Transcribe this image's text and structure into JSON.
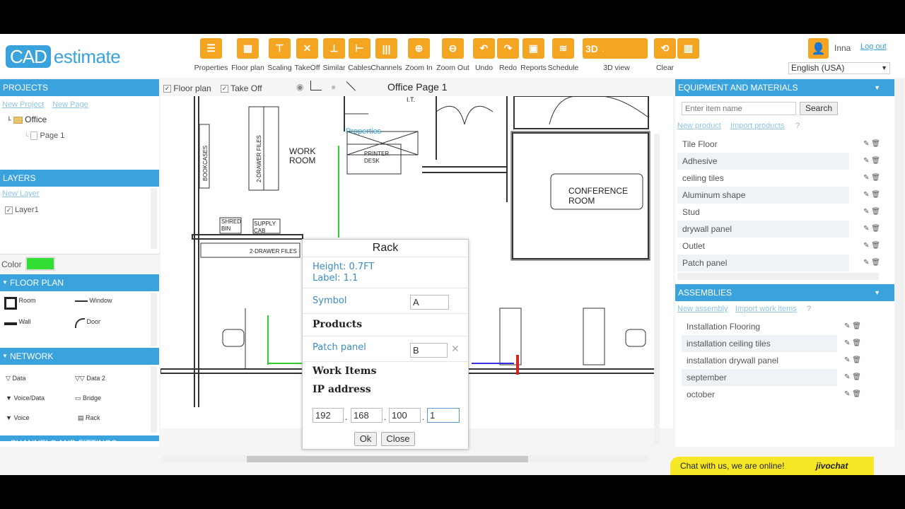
{
  "logo": {
    "part1": "CAD",
    "part2": "estimate"
  },
  "toolbar": [
    {
      "label": "Properties",
      "icon": "list-icon",
      "glyph": "☰"
    },
    {
      "label": "Floor plan",
      "icon": "grid-icon",
      "glyph": "▦"
    },
    {
      "label": "Scaling",
      "icon": "ruler-icon",
      "glyph": "⊤"
    },
    {
      "label": "TakeOff",
      "icon": "cross-icon",
      "glyph": "✕"
    },
    {
      "label": "Similar",
      "icon": "stamp-icon",
      "glyph": "⊥"
    },
    {
      "label": "Cables",
      "icon": "cable-icon",
      "glyph": "⊢"
    },
    {
      "label": "Channels",
      "icon": "channels-icon",
      "glyph": "|||"
    },
    {
      "label": "Zoom In",
      "icon": "zoom-in-icon",
      "glyph": "⊕"
    },
    {
      "label": "Zoom Out",
      "icon": "zoom-out-icon",
      "glyph": "⊖"
    },
    {
      "label": "Undo",
      "icon": "undo-icon",
      "glyph": "↶"
    },
    {
      "label": "Redo",
      "icon": "redo-icon",
      "glyph": "↷"
    },
    {
      "label": "Reports",
      "icon": "reports-icon",
      "glyph": "▣"
    },
    {
      "label": "Schedule",
      "icon": "schedule-icon",
      "glyph": "≋"
    }
  ],
  "view3d": {
    "label": "3D view",
    "badge": "3D"
  },
  "clear": {
    "label": "Clear"
  },
  "user": {
    "name": "Inna",
    "logout": "Log out"
  },
  "language": "English (USA)",
  "projects": {
    "header": "PROJECTS",
    "new_project": "New Project",
    "new_page": "New Page",
    "tree": [
      {
        "label": "Office"
      },
      {
        "label": "Page 1"
      }
    ]
  },
  "layers": {
    "header": "LAYERS",
    "new_layer": "New Layer",
    "items": [
      "Layer1"
    ],
    "color_label": "Color",
    "color": "#33dd33"
  },
  "floor_plan": {
    "header": "FLOOR PLAN",
    "items": [
      "Room",
      "Window",
      "Wall",
      "Door"
    ]
  },
  "network": {
    "header": "NETWORK",
    "items": [
      "Data",
      "Data 2",
      "Voice/Data",
      "Bridge",
      "Voice",
      "Rack"
    ]
  },
  "channels_header": "CHANNELS AND FITTINGS",
  "canvas": {
    "floor_plan_check": "Floor plan",
    "takeoff_check": "Take Off",
    "page_title": "Office Page 1",
    "properties_tooltip": "Properties",
    "labels": {
      "it": "I.T.",
      "bookcases": "BOOKCASES",
      "drawer_files_v": "2-DRAWER FILES",
      "work_room": "WORK ROOM",
      "printer_desk": "PRINTER DESK",
      "conference_room": "CONFERENCE ROOM",
      "shred_bin": "SHRED BIN",
      "supply_cab": "SUPPLY CAB",
      "drawer_files_h": "2-DRAWER FILES"
    }
  },
  "equipment": {
    "header": "EQUIPMENT AND MATERIALS",
    "search_placeholder": "Enter item name",
    "search_button": "Search",
    "new_product": "New product",
    "import_products": "Import products",
    "help": "?",
    "items": [
      "Tile Floor",
      "Adhesive",
      "ceiling tiles",
      "Aluminum shape",
      "Stud",
      "drywall panel",
      "Outlet",
      "Patch panel"
    ]
  },
  "assemblies": {
    "header": "ASSEMBLIES",
    "new_assembly": "New assembly",
    "import_work_items": "Import work items",
    "help": "?",
    "items": [
      "Installation Flooring",
      "installation ceiling tiles",
      "installation drywall panel",
      "september",
      "october"
    ]
  },
  "dialog": {
    "title": "Rack",
    "height": "Height: 0.7FT",
    "label": "Label: 1.1",
    "symbol_label": "Symbol",
    "symbol_value": "A",
    "products_heading": "Products",
    "patch_panel_label": "Patch panel",
    "patch_panel_value": "B",
    "work_items_heading": "Work Items",
    "ip_heading": "IP address",
    "ip": [
      "192",
      "168",
      "100",
      "1"
    ],
    "ok": "Ok",
    "close": "Close"
  },
  "chat": {
    "text": "Chat with us, we are online!",
    "brand": "jivochat"
  }
}
